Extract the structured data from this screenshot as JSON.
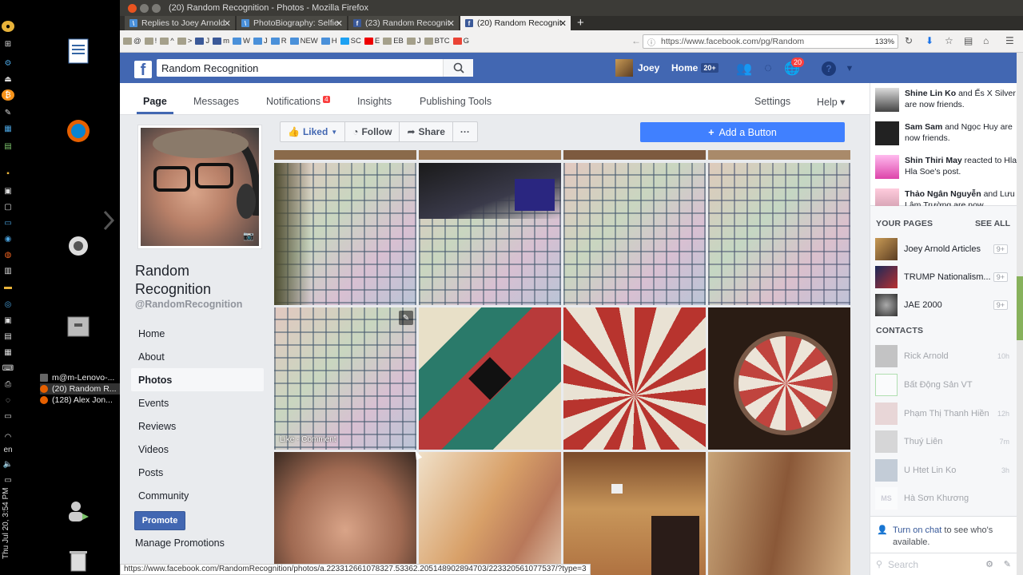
{
  "window": {
    "title": "(20) Random Recognition - Photos - Mozilla Firefox"
  },
  "tabs": [
    {
      "label": "Replies to Joey Arnold",
      "fav": "fb-blue"
    },
    {
      "label": "PhotoBiography: Selfie",
      "fav": "fb-blue"
    },
    {
      "label": "(23) Random Recognit",
      "fav": "facebook"
    },
    {
      "label": "(20) Random Recognit",
      "fav": "facebook",
      "active": true
    }
  ],
  "bookmarks": [
    "@",
    "!",
    "^",
    ">",
    "J",
    "m",
    "W",
    "J",
    "R",
    "NEW",
    "H",
    "SC",
    "E",
    "EB",
    "J",
    "BTC",
    "G"
  ],
  "address": {
    "url": "https://www.facebook.com/pg/Random",
    "zoom": "133%"
  },
  "fb": {
    "search_value": "Random Recognition",
    "user_name": "Joey",
    "home_label": "Home",
    "home_count": "20+",
    "notif_count": "20"
  },
  "pagenav": {
    "page": "Page",
    "messages": "Messages",
    "notifications": "Notifications",
    "notifications_badge": "4",
    "insights": "Insights",
    "publishing": "Publishing Tools",
    "settings": "Settings",
    "help": "Help ▾"
  },
  "page": {
    "name": "Random Recognition",
    "handle": "@RandomRecognition",
    "nav": [
      "Home",
      "About",
      "Photos",
      "Events",
      "Reviews",
      "Videos",
      "Posts",
      "Community"
    ],
    "promote": "Promote",
    "manage": "Manage Promotions"
  },
  "actions": {
    "liked": "Liked",
    "follow": "Follow",
    "share": "Share",
    "more": "···",
    "add_button": "Add a Button"
  },
  "photo_caption": "Like · Comment",
  "ticker": [
    {
      "name": "Shine Lin Ko",
      "rest": " and Ếs X Silver are now friends."
    },
    {
      "name": "Sam Sam",
      "rest": " and Ngọc Huy are now friends."
    },
    {
      "name": "Shin Thiri May",
      "rest": " reacted to Hla Hla Soe's post."
    },
    {
      "name": "Thảo Ngân Nguyễn",
      "rest": " and Lưu Lâm Trường are now"
    }
  ],
  "your_pages": {
    "heading": "YOUR PAGES",
    "see_all": "SEE ALL",
    "items": [
      {
        "name": "Joey Arnold Articles",
        "count": "9+"
      },
      {
        "name": "TRUMP Nationalism...",
        "count": "9+"
      },
      {
        "name": "JAE 2000",
        "count": "9+"
      }
    ]
  },
  "contacts": {
    "heading": "CONTACTS",
    "items": [
      {
        "name": "Rick Arnold",
        "ago": "10h"
      },
      {
        "name": "Bất Động Sản VT",
        "ago": ""
      },
      {
        "name": "Phạm Thị Thanh Hiền",
        "ago": "12h"
      },
      {
        "name": "Thuý Liên",
        "ago": "7m"
      },
      {
        "name": "U Htet Lin Ko",
        "ago": "3h"
      },
      {
        "name": "Hà Sơn Khương",
        "ago": ""
      }
    ]
  },
  "chat": {
    "link": "Turn on chat",
    "rest": " to see who's available.",
    "search": "Search"
  },
  "status_url": "https://www.facebook.com/RandomRecognition/photos/a.223312661078327.53362.205148902894703/223320561077537/?type=3",
  "dock": {
    "tasks": [
      "m@m-Lenovo-...",
      "(20) Random R...",
      "(128) Alex Jon..."
    ],
    "lang": "en",
    "clock": "Thu Jul 20, 3:54 PM"
  },
  "colors": {
    "fb_blue": "#4267b2",
    "add_button": "#4080ff",
    "badge_red": "#fa3e3e"
  }
}
